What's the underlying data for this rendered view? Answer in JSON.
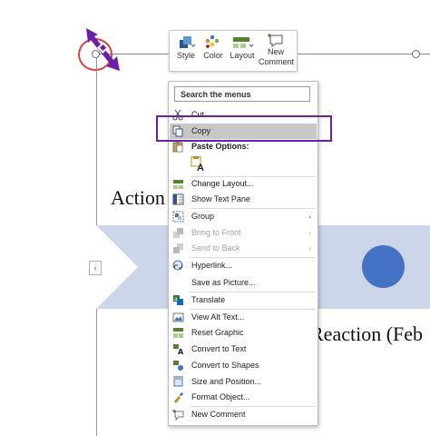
{
  "slide": {
    "text_action": "Action",
    "text_reaction": "Reaction (Feb",
    "collapse_glyph": "‹",
    "circle_color": "#4472c4",
    "band_color": "#cdd5ea"
  },
  "mini_toolbar": {
    "items": [
      {
        "label": "Style",
        "icon": "style-icon"
      },
      {
        "label": "Color",
        "icon": "color-icon"
      },
      {
        "label": "Layout",
        "icon": "layout-icon"
      },
      {
        "label_line1": "New",
        "label_line2": "Comment",
        "icon": "new-comment-icon"
      }
    ]
  },
  "context_menu": {
    "search_placeholder": "Search the menus",
    "items": [
      {
        "label": "Cut",
        "icon": "scissors-icon",
        "enabled": true
      },
      {
        "label": "Copy",
        "icon": "copy-icon",
        "enabled": true,
        "highlighted": true
      },
      {
        "label": "Paste Options:",
        "icon": "paste-icon",
        "section_header": true
      },
      {
        "label": "",
        "icon": "paste-keep-text-icon"
      },
      {
        "label": "Change Layout...",
        "icon": "change-layout-icon",
        "enabled": true
      },
      {
        "label": "Show Text Pane",
        "icon": "text-pane-icon",
        "enabled": true
      },
      {
        "label": "Group",
        "icon": "group-icon",
        "enabled": true,
        "submenu": true
      },
      {
        "label": "Bring to Front",
        "icon": "bring-front-icon",
        "enabled": false,
        "submenu": true
      },
      {
        "label": "Send to Back",
        "icon": "send-back-icon",
        "enabled": false,
        "submenu": true
      },
      {
        "label": "Hyperlink...",
        "icon": "link-icon",
        "enabled": true
      },
      {
        "label": "Save as Picture...",
        "icon": "",
        "enabled": true
      },
      {
        "label": "Translate",
        "icon": "translate-icon",
        "enabled": true
      },
      {
        "label": "View Alt Text...",
        "icon": "alt-text-icon",
        "enabled": true
      },
      {
        "label": "Reset Graphic",
        "icon": "reset-graphic-icon",
        "enabled": true
      },
      {
        "label": "Convert to Text",
        "icon": "convert-text-icon",
        "enabled": true
      },
      {
        "label": "Convert to Shapes",
        "icon": "convert-shapes-icon",
        "enabled": true
      },
      {
        "label": "Size and Position...",
        "icon": "size-position-icon",
        "enabled": true
      },
      {
        "label": "Format Object...",
        "icon": "format-object-icon",
        "enabled": true
      },
      {
        "label": "New Comment",
        "icon": "new-comment-icon",
        "enabled": true
      }
    ],
    "submenu_arrow": "›",
    "paste_glyph": "A"
  },
  "annotations": {
    "red_circle_color": "#d94040",
    "purple_box_color": "#6a1fa8",
    "arrow_color": "#6a1fa8"
  }
}
